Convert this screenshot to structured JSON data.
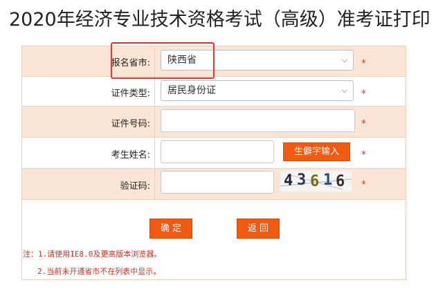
{
  "page": {
    "title": "2020年经济专业技术资格考试（高级）准考证打印"
  },
  "form": {
    "province_label": "报名省市:",
    "province_value": "陕西省",
    "id_type_label": "证件类型:",
    "id_type_value": "居民身份证",
    "id_number_label": "证件号码:",
    "name_label": "考生姓名:",
    "rare_char_button": "生僻字输入",
    "captcha_label": "验证码:",
    "captcha_chars": [
      "4",
      "3",
      "6",
      "1",
      "6"
    ],
    "required_mark": "*"
  },
  "buttons": {
    "confirm": "确 定",
    "back": "返 回"
  },
  "notes": {
    "line1": "注：1.请使用IE8.0及更高版本浏览器。",
    "line2": "2.当前未开通省市不在列表中显示。"
  },
  "colors": {
    "accent": "#f05a13",
    "shade": "#fbe6d5",
    "required": "#e8302a"
  },
  "icons": {
    "select_arrow": "chevron-down-icon"
  }
}
